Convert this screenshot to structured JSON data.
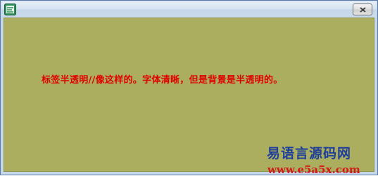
{
  "window": {
    "icon": "app-icon",
    "close_icon": "close-icon"
  },
  "content": {
    "label_text": "标签半透明//像这样的。字体清晰，但是背景是半透明的。",
    "background_color": "#abae5f",
    "text_color": "#e00000"
  },
  "watermark": {
    "title": "易语言源码网",
    "url": "www.e5a5x.com",
    "title_color": "#1e3f9b",
    "url_color": "#d21a1a"
  }
}
